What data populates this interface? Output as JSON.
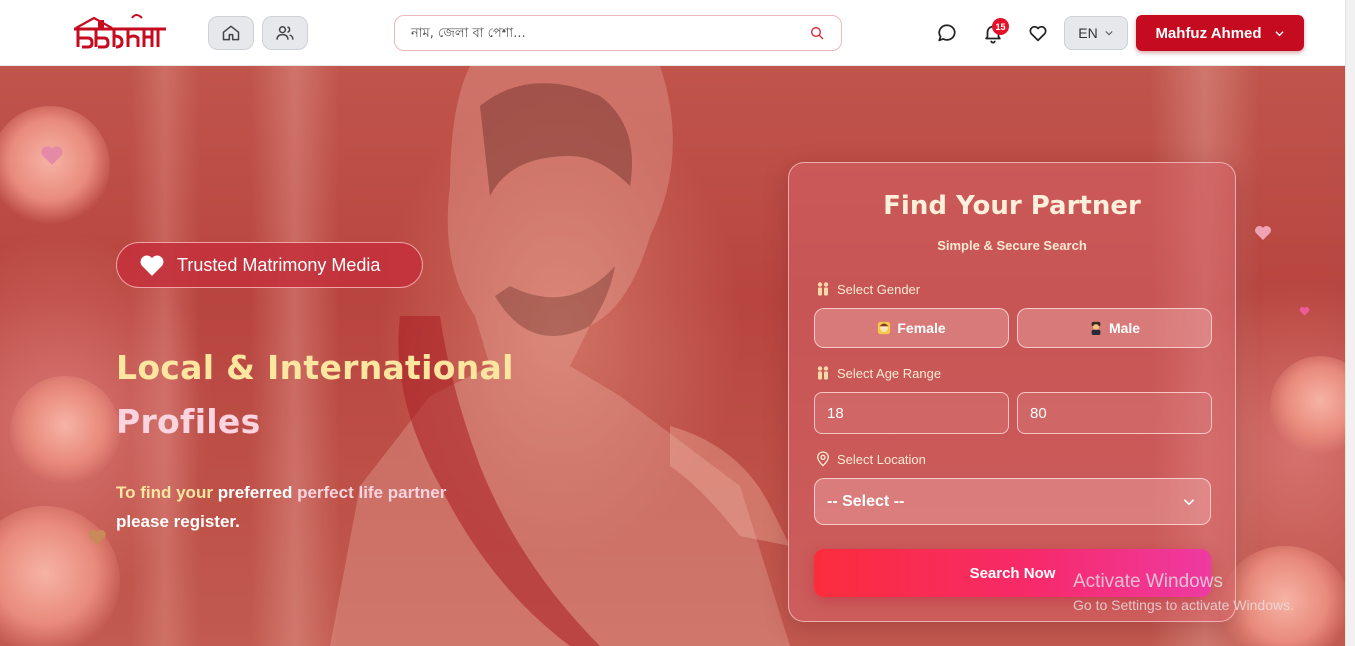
{
  "brand": {
    "logo_text": "বিবাহশাদী"
  },
  "nav": {
    "search_placeholder": "নাম, জেলা বা পেশা...",
    "notification_count": "15",
    "language": "EN",
    "user_name": "Mahfuz Ahmed"
  },
  "hero": {
    "badge": "Trusted Matrimony Media",
    "heading_line1": "Local & International",
    "heading_line2": "Profiles",
    "subtitle_part1": "To find your",
    "subtitle_part2": "preferred",
    "subtitle_part3": "perfect life partner",
    "subtitle_part4": "please register."
  },
  "search_card": {
    "title": "Find Your Partner",
    "subtitle": "Simple & Secure Search",
    "gender_label": "Select Gender",
    "gender_options": [
      "Female",
      "Male"
    ],
    "age_label": "Select Age Range",
    "age_min": "18",
    "age_max": "80",
    "location_label": "Select Location",
    "location_value": "-- Select --",
    "submit_label": "Search Now"
  },
  "watermark": {
    "line1": "Activate Windows",
    "line2": "Go to Settings to activate Windows."
  },
  "colors": {
    "brand_red": "#c40b1f",
    "badge_red": "#e1122a",
    "accent_gradient_start": "#fb2d3c",
    "accent_gradient_end": "#ee3aa2",
    "heading_yellow": "#fde6a0",
    "heading_pink": "#fbd4e0"
  },
  "icons": {
    "home": "home-icon",
    "people": "users-icon",
    "search": "search-icon",
    "chat": "chat-icon",
    "bell": "bell-icon",
    "heart": "heart-icon",
    "chevron": "chevron-down-icon",
    "location": "location-pin-icon",
    "couple": "couple-icon"
  }
}
